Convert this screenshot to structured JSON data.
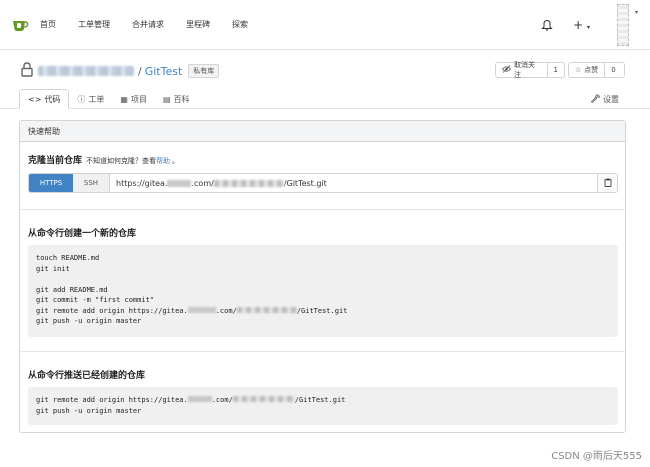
{
  "nav": {
    "items": [
      "首页",
      "工单管理",
      "合并请求",
      "里程碑",
      "探索"
    ],
    "plus": "+"
  },
  "repo": {
    "slash": "/",
    "name": "GitTest",
    "private_label": "私有库",
    "watch_label": "取消关注",
    "watch_count": "1",
    "star_label": "点赞",
    "star_count": "0"
  },
  "tabs": [
    {
      "icon": "<>",
      "label": "代码"
    },
    {
      "icon": "ⓘ",
      "label": "工单"
    },
    {
      "icon": "▦",
      "label": "项目"
    },
    {
      "icon": "▤",
      "label": "百科"
    }
  ],
  "settings_label": "设置",
  "quick_help": {
    "title": "快速帮助",
    "clone_title": "克隆当前仓库",
    "clone_hint": "不知道如何克隆？查看",
    "clone_help_link": "帮助",
    "clone_hint_end": "。",
    "https_label": "HTTPS",
    "ssh_label": "SSH",
    "url_prefix": "https://gitea.",
    "url_mid": ".com/",
    "url_suffix": "/GitTest.git",
    "new_repo_title": "从命令行创建一个新的仓库",
    "new_repo_lines": [
      "touch README.md",
      "git init",
      "",
      "git add README.md",
      "git commit -m \"first commit\"",
      "git remote add origin https://gitea.",
      "git push -u origin master"
    ],
    "new_repo_remote_mid": ".com/",
    "new_repo_remote_suffix": "/GitTest.git",
    "push_title": "从命令行推送已经创建的仓库",
    "push_remote_prefix": "git remote add origin https://gitea.",
    "push_remote_mid": ".com/",
    "push_remote_suffix": "/GitTest.git",
    "push_line2": "git push -u origin master"
  },
  "watermark": "CSDN @雨后天555",
  "colors": {
    "accent": "#4183c4",
    "logo_green": "#609926"
  }
}
